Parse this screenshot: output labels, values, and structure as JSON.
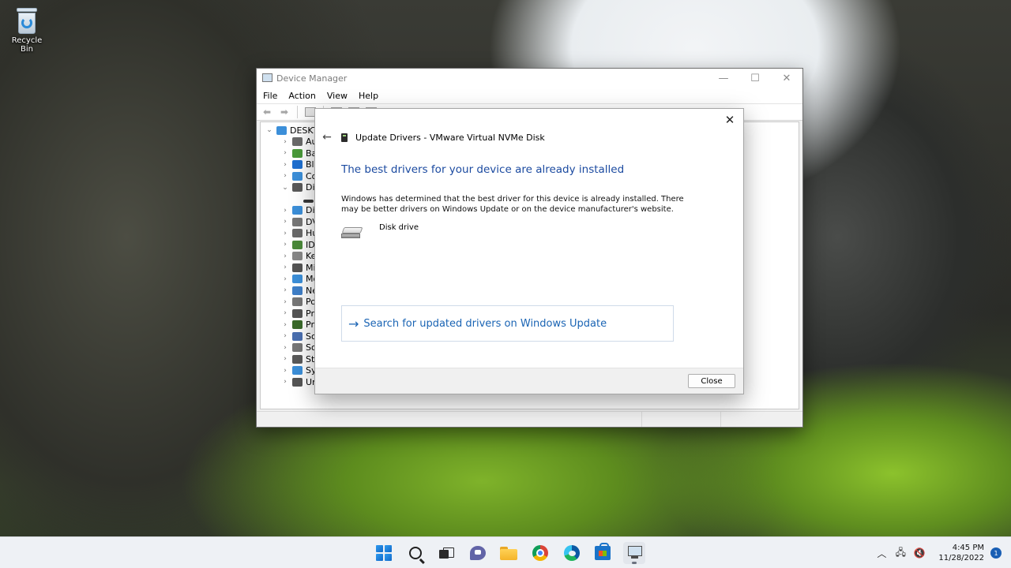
{
  "desktop": {
    "recycle_bin_label": "Recycle Bin"
  },
  "device_manager": {
    "title": "Device Manager",
    "menu": [
      "File",
      "Action",
      "View",
      "Help"
    ],
    "tree": {
      "root": "DESKTOP",
      "items": [
        {
          "label": "Au",
          "icon_color": "#6a6a6a",
          "expanded": false
        },
        {
          "label": "Bat",
          "icon_color": "#4a9a3a",
          "expanded": false
        },
        {
          "label": "Blu",
          "icon_color": "#1e6fd0",
          "expanded": false
        },
        {
          "label": "Co",
          "icon_color": "#3c8fd9",
          "expanded": false
        },
        {
          "label": "Dis",
          "icon_color": "#5a5a5a",
          "expanded": true
        },
        {
          "label": "",
          "icon_color": "#3a3a3a",
          "expanded": null,
          "child": true
        },
        {
          "label": "Dis",
          "icon_color": "#3c8fd9",
          "expanded": false
        },
        {
          "label": "DV",
          "icon_color": "#777777",
          "expanded": false
        },
        {
          "label": "Hu",
          "icon_color": "#6a6a6a",
          "expanded": false
        },
        {
          "label": "IDE",
          "icon_color": "#4b8a3a",
          "expanded": false
        },
        {
          "label": "Key",
          "icon_color": "#888888",
          "expanded": false
        },
        {
          "label": "Mi",
          "icon_color": "#555555",
          "expanded": false
        },
        {
          "label": "Mo",
          "icon_color": "#3c8fd9",
          "expanded": false
        },
        {
          "label": "Ne",
          "icon_color": "#3f7fc8",
          "expanded": false
        },
        {
          "label": "Po",
          "icon_color": "#777777",
          "expanded": false
        },
        {
          "label": "Pri",
          "icon_color": "#555555",
          "expanded": false
        },
        {
          "label": "Pro",
          "icon_color": "#3a6a2a",
          "expanded": false
        },
        {
          "label": "Sof",
          "icon_color": "#4a6fb0",
          "expanded": false
        },
        {
          "label": "Sou",
          "icon_color": "#777777",
          "expanded": false
        },
        {
          "label": "Sto",
          "icon_color": "#5a5a5a",
          "expanded": false
        },
        {
          "label": "Sys",
          "icon_color": "#3c8fd9",
          "expanded": false
        },
        {
          "label": "Un",
          "icon_color": "#555555",
          "expanded": false
        }
      ]
    }
  },
  "dialog": {
    "header_title": "Update Drivers - VMware Virtual NVMe Disk",
    "heading": "The best drivers for your device are already installed",
    "description": "Windows has determined that the best driver for this device is already installed. There may be better drivers on Windows Update or on the device manufacturer's website.",
    "device_name": "Disk drive",
    "option_text": "Search for updated drivers on Windows Update",
    "close_button": "Close",
    "accent_color": "#1b4aa0",
    "link_color": "#1a64b4"
  },
  "taskbar": {
    "apps": [
      {
        "name": "start",
        "icon": "windows-start-icon"
      },
      {
        "name": "search",
        "icon": "search-icon"
      },
      {
        "name": "task-view",
        "icon": "task-view-icon"
      },
      {
        "name": "teams-chat",
        "icon": "teams-chat-icon"
      },
      {
        "name": "file-explorer",
        "icon": "folder-icon"
      },
      {
        "name": "chrome",
        "icon": "chrome-icon"
      },
      {
        "name": "edge",
        "icon": "edge-icon"
      },
      {
        "name": "store",
        "icon": "store-icon"
      },
      {
        "name": "device-manager",
        "icon": "device-manager-icon",
        "active": true
      }
    ],
    "clock_time": "4:45 PM",
    "clock_date": "11/28/2022",
    "notification_count": "1"
  }
}
